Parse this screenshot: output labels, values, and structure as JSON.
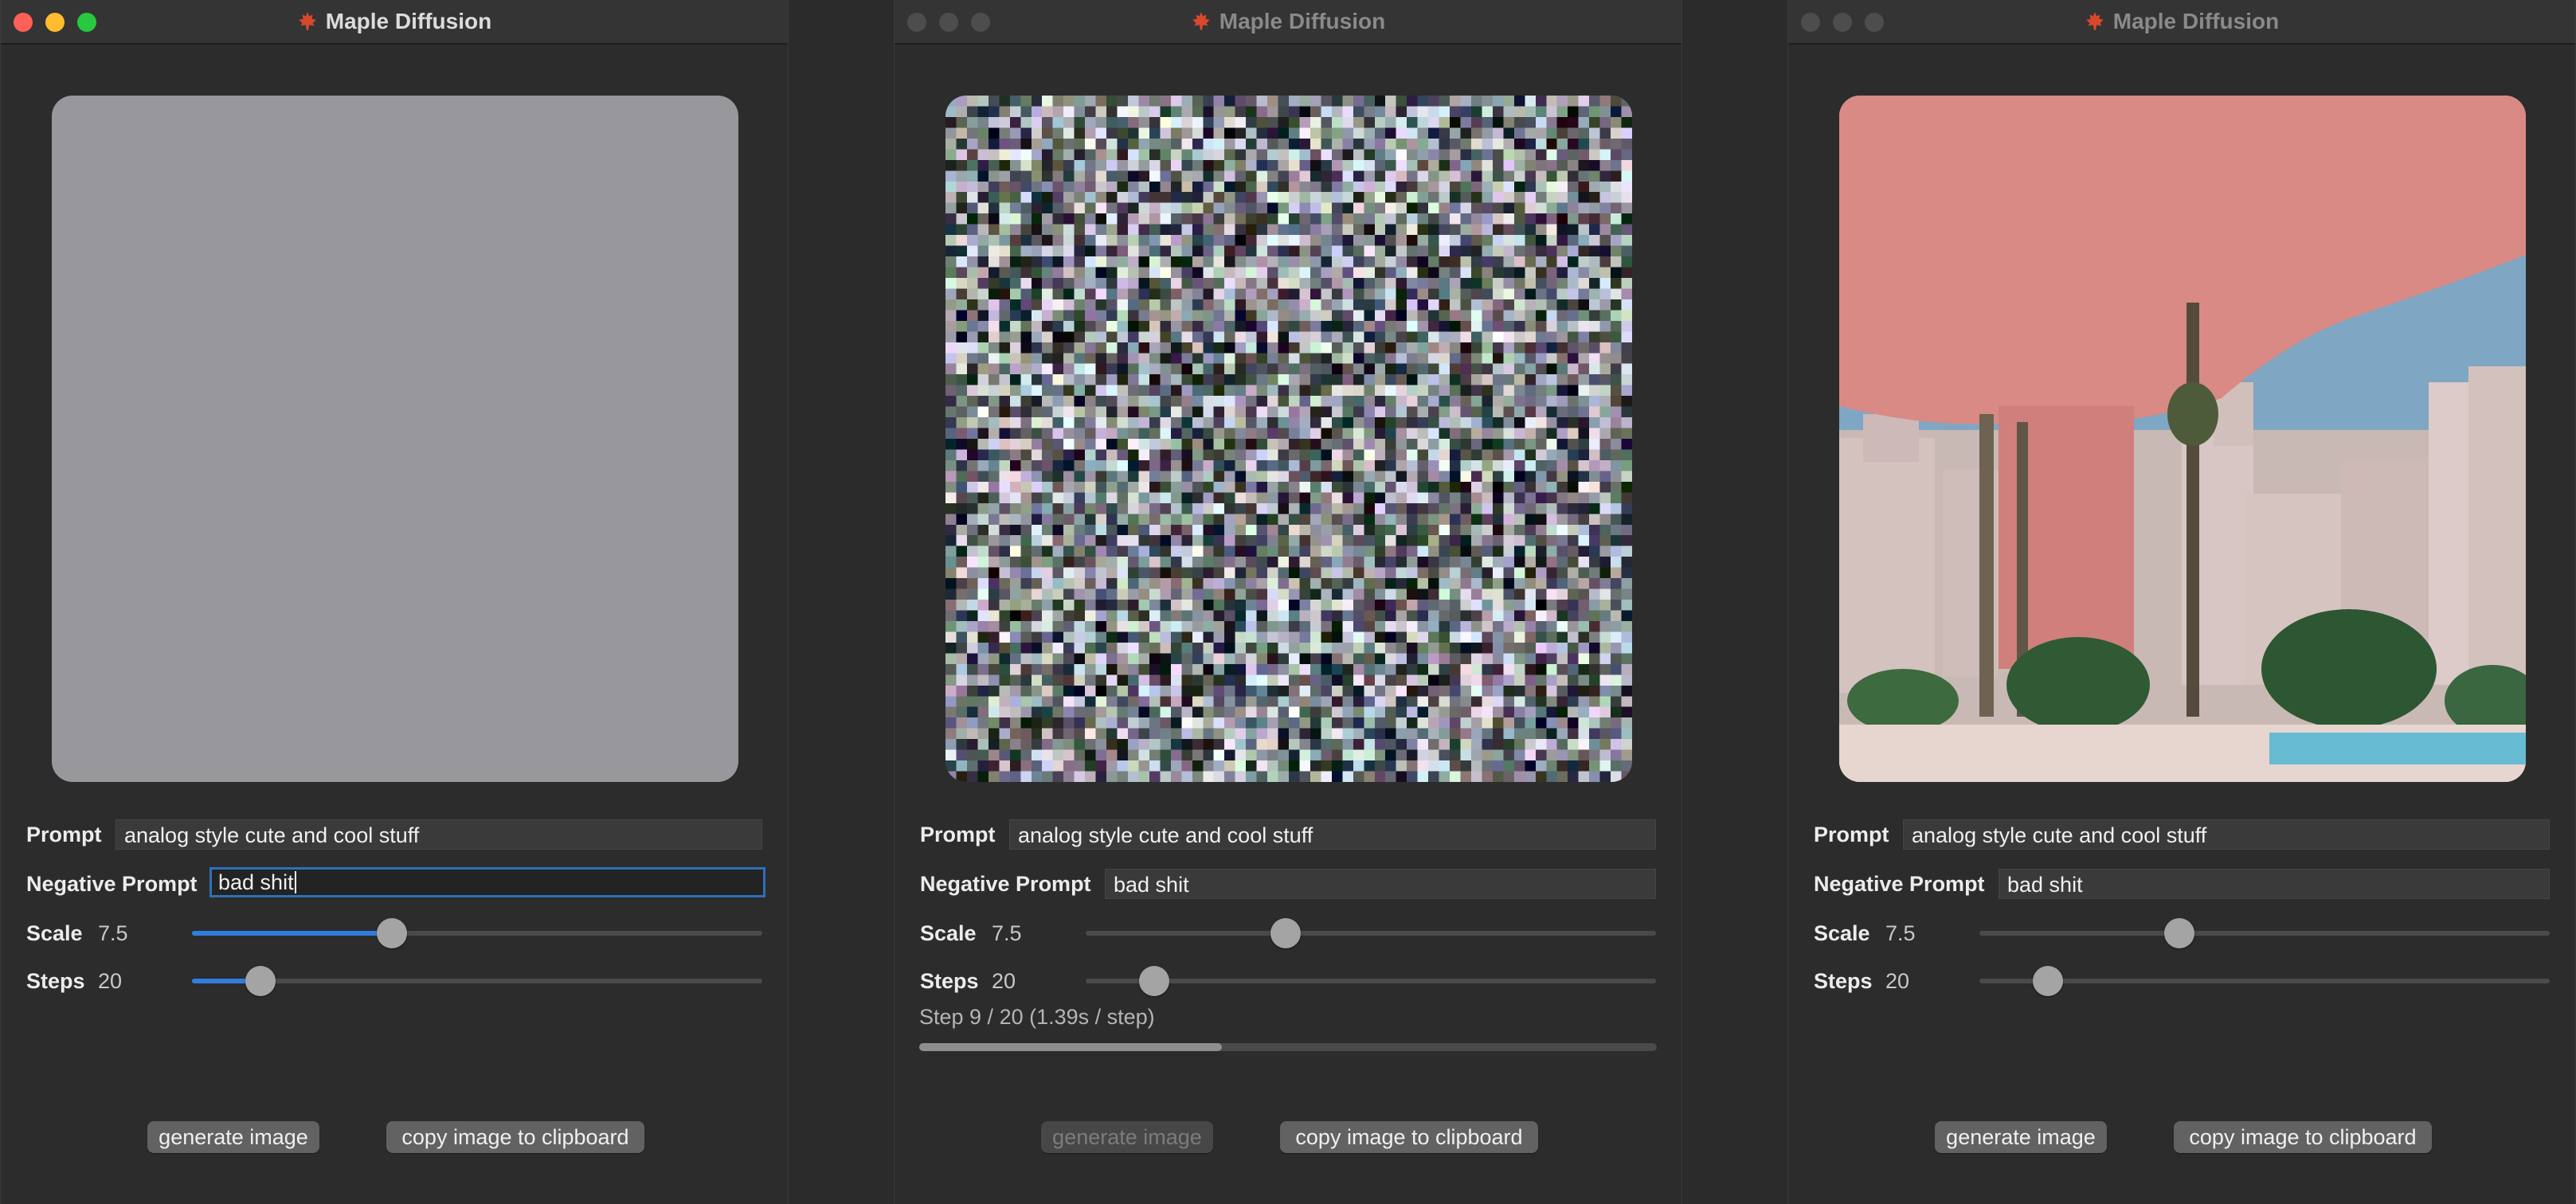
{
  "app": {
    "title": "Maple Diffusion"
  },
  "colors": {
    "close": "#fe5f57",
    "minimize": "#febc2e",
    "zoom": "#28c840",
    "inactive_light": "#4d4d4d",
    "accent": "#2f7de1"
  },
  "windows": [
    {
      "state": "idle",
      "prompt": {
        "label": "Prompt",
        "value": "analog style cute and cool stuff"
      },
      "negative_prompt": {
        "label": "Negative Prompt",
        "value": "bad shit"
      },
      "scale": {
        "label": "Scale",
        "value": "7.5",
        "level": 0.35
      },
      "steps": {
        "label": "Steps",
        "value": "20",
        "level": 0.12
      },
      "buttons": {
        "generate": "generate image",
        "copy": "copy image to clipboard"
      }
    },
    {
      "state": "generating",
      "prompt": {
        "label": "Prompt",
        "value": "analog style cute and cool stuff"
      },
      "negative_prompt": {
        "label": "Negative Prompt",
        "value": "bad shit"
      },
      "scale": {
        "label": "Scale",
        "value": "7.5",
        "level": 0.35
      },
      "steps": {
        "label": "Steps",
        "value": "20",
        "level": 0.12
      },
      "status": "Step 9 / 20 (1.39s / step)",
      "progress": 0.41,
      "buttons": {
        "generate": "generate image",
        "copy": "copy image to clipboard"
      }
    },
    {
      "state": "done",
      "prompt": {
        "label": "Prompt",
        "value": "analog style cute and cool stuff"
      },
      "negative_prompt": {
        "label": "Negative Prompt",
        "value": "bad shit"
      },
      "scale": {
        "label": "Scale",
        "value": "7.5",
        "level": 0.35
      },
      "steps": {
        "label": "Steps",
        "value": "20",
        "level": 0.12
      },
      "buttons": {
        "generate": "generate image",
        "copy": "copy image to clipboard"
      }
    }
  ]
}
